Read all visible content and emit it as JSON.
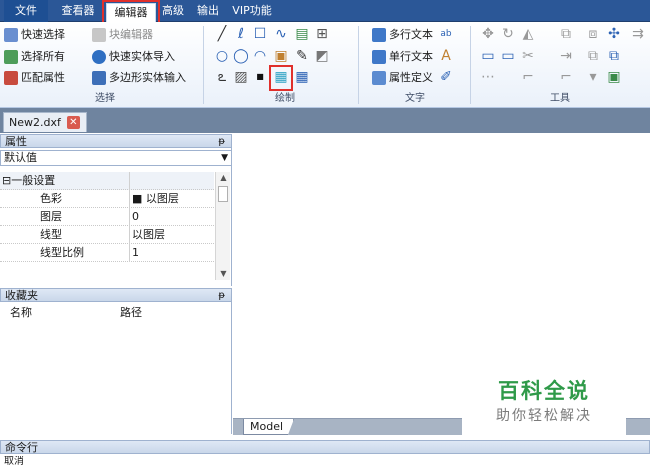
{
  "tabs": [
    {
      "label": "文件"
    },
    {
      "label": "查看器"
    },
    {
      "label": "编辑器"
    },
    {
      "label": "高级"
    },
    {
      "label": "输出"
    },
    {
      "label": "VIP功能"
    }
  ],
  "ribbon": {
    "select_group": {
      "title": "选择",
      "items": [
        "快速选择",
        "块编辑器",
        "选择所有",
        "快速实体导入",
        "匹配属性",
        "多边形实体输入"
      ]
    },
    "draw_group": {
      "title": "绘制"
    },
    "text_group": {
      "title": "文字",
      "items": [
        "多行文本",
        "单行文本",
        "属性定义"
      ]
    },
    "tools_group": {
      "title": "工具"
    }
  },
  "document": {
    "tab_label": "New2.dxf"
  },
  "properties_panel": {
    "title": "属性",
    "selector_value": "默认值",
    "section": "一般设置",
    "rows": [
      {
        "key": "色彩",
        "value": "■ 以图层"
      },
      {
        "key": "图层",
        "value": "0"
      },
      {
        "key": "线型",
        "value": "以图层"
      },
      {
        "key": "线型比例",
        "value": "1"
      }
    ]
  },
  "favorites_panel": {
    "title": "收藏夹",
    "col_name": "名称",
    "col_path": "路径"
  },
  "layout": {
    "model_tab": "Model"
  },
  "command": {
    "title": "命令行",
    "text": "取消"
  },
  "watermark": {
    "title": "百科全说",
    "subtitle": "助你轻松解决"
  },
  "colors": {
    "tabbar": "#2b5797",
    "highlight": "#e0302c",
    "watermark": "#2f9a49"
  }
}
